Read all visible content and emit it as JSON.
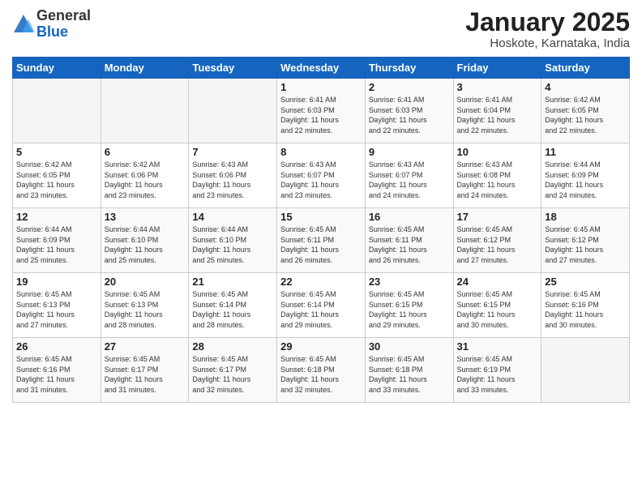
{
  "logo": {
    "general": "General",
    "blue": "Blue"
  },
  "title": "January 2025",
  "location": "Hoskote, Karnataka, India",
  "days_of_week": [
    "Sunday",
    "Monday",
    "Tuesday",
    "Wednesday",
    "Thursday",
    "Friday",
    "Saturday"
  ],
  "weeks": [
    [
      {
        "day": "",
        "info": ""
      },
      {
        "day": "",
        "info": ""
      },
      {
        "day": "",
        "info": ""
      },
      {
        "day": "1",
        "info": "Sunrise: 6:41 AM\nSunset: 6:03 PM\nDaylight: 11 hours\nand 22 minutes."
      },
      {
        "day": "2",
        "info": "Sunrise: 6:41 AM\nSunset: 6:03 PM\nDaylight: 11 hours\nand 22 minutes."
      },
      {
        "day": "3",
        "info": "Sunrise: 6:41 AM\nSunset: 6:04 PM\nDaylight: 11 hours\nand 22 minutes."
      },
      {
        "day": "4",
        "info": "Sunrise: 6:42 AM\nSunset: 6:05 PM\nDaylight: 11 hours\nand 22 minutes."
      }
    ],
    [
      {
        "day": "5",
        "info": "Sunrise: 6:42 AM\nSunset: 6:05 PM\nDaylight: 11 hours\nand 23 minutes."
      },
      {
        "day": "6",
        "info": "Sunrise: 6:42 AM\nSunset: 6:06 PM\nDaylight: 11 hours\nand 23 minutes."
      },
      {
        "day": "7",
        "info": "Sunrise: 6:43 AM\nSunset: 6:06 PM\nDaylight: 11 hours\nand 23 minutes."
      },
      {
        "day": "8",
        "info": "Sunrise: 6:43 AM\nSunset: 6:07 PM\nDaylight: 11 hours\nand 23 minutes."
      },
      {
        "day": "9",
        "info": "Sunrise: 6:43 AM\nSunset: 6:07 PM\nDaylight: 11 hours\nand 24 minutes."
      },
      {
        "day": "10",
        "info": "Sunrise: 6:43 AM\nSunset: 6:08 PM\nDaylight: 11 hours\nand 24 minutes."
      },
      {
        "day": "11",
        "info": "Sunrise: 6:44 AM\nSunset: 6:09 PM\nDaylight: 11 hours\nand 24 minutes."
      }
    ],
    [
      {
        "day": "12",
        "info": "Sunrise: 6:44 AM\nSunset: 6:09 PM\nDaylight: 11 hours\nand 25 minutes."
      },
      {
        "day": "13",
        "info": "Sunrise: 6:44 AM\nSunset: 6:10 PM\nDaylight: 11 hours\nand 25 minutes."
      },
      {
        "day": "14",
        "info": "Sunrise: 6:44 AM\nSunset: 6:10 PM\nDaylight: 11 hours\nand 25 minutes."
      },
      {
        "day": "15",
        "info": "Sunrise: 6:45 AM\nSunset: 6:11 PM\nDaylight: 11 hours\nand 26 minutes."
      },
      {
        "day": "16",
        "info": "Sunrise: 6:45 AM\nSunset: 6:11 PM\nDaylight: 11 hours\nand 26 minutes."
      },
      {
        "day": "17",
        "info": "Sunrise: 6:45 AM\nSunset: 6:12 PM\nDaylight: 11 hours\nand 27 minutes."
      },
      {
        "day": "18",
        "info": "Sunrise: 6:45 AM\nSunset: 6:12 PM\nDaylight: 11 hours\nand 27 minutes."
      }
    ],
    [
      {
        "day": "19",
        "info": "Sunrise: 6:45 AM\nSunset: 6:13 PM\nDaylight: 11 hours\nand 27 minutes."
      },
      {
        "day": "20",
        "info": "Sunrise: 6:45 AM\nSunset: 6:13 PM\nDaylight: 11 hours\nand 28 minutes."
      },
      {
        "day": "21",
        "info": "Sunrise: 6:45 AM\nSunset: 6:14 PM\nDaylight: 11 hours\nand 28 minutes."
      },
      {
        "day": "22",
        "info": "Sunrise: 6:45 AM\nSunset: 6:14 PM\nDaylight: 11 hours\nand 29 minutes."
      },
      {
        "day": "23",
        "info": "Sunrise: 6:45 AM\nSunset: 6:15 PM\nDaylight: 11 hours\nand 29 minutes."
      },
      {
        "day": "24",
        "info": "Sunrise: 6:45 AM\nSunset: 6:15 PM\nDaylight: 11 hours\nand 30 minutes."
      },
      {
        "day": "25",
        "info": "Sunrise: 6:45 AM\nSunset: 6:16 PM\nDaylight: 11 hours\nand 30 minutes."
      }
    ],
    [
      {
        "day": "26",
        "info": "Sunrise: 6:45 AM\nSunset: 6:16 PM\nDaylight: 11 hours\nand 31 minutes."
      },
      {
        "day": "27",
        "info": "Sunrise: 6:45 AM\nSunset: 6:17 PM\nDaylight: 11 hours\nand 31 minutes."
      },
      {
        "day": "28",
        "info": "Sunrise: 6:45 AM\nSunset: 6:17 PM\nDaylight: 11 hours\nand 32 minutes."
      },
      {
        "day": "29",
        "info": "Sunrise: 6:45 AM\nSunset: 6:18 PM\nDaylight: 11 hours\nand 32 minutes."
      },
      {
        "day": "30",
        "info": "Sunrise: 6:45 AM\nSunset: 6:18 PM\nDaylight: 11 hours\nand 33 minutes."
      },
      {
        "day": "31",
        "info": "Sunrise: 6:45 AM\nSunset: 6:19 PM\nDaylight: 11 hours\nand 33 minutes."
      },
      {
        "day": "",
        "info": ""
      }
    ]
  ]
}
